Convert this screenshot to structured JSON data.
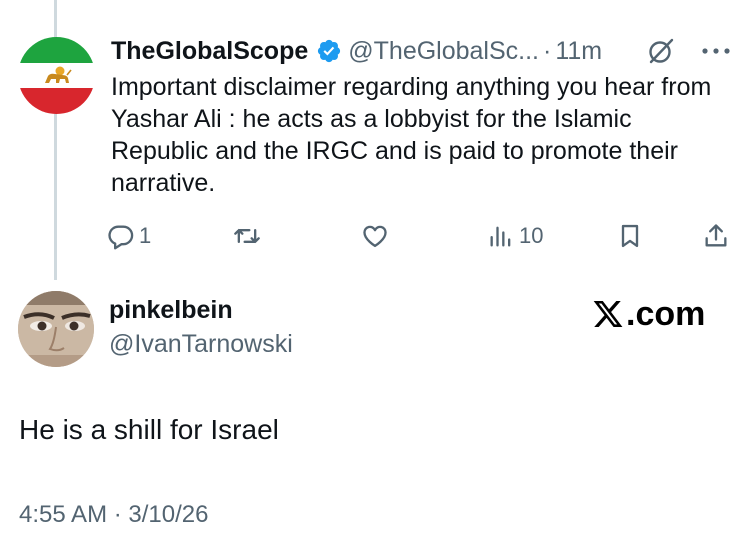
{
  "parent_tweet": {
    "author_name": "TheGlobalScope",
    "author_handle": "@TheGlobalSc...",
    "separator": "·",
    "time": "11m",
    "body": "Important disclaimer regarding anything you hear from Yashar Ali : he acts as a lobbyist for the Islamic Republic and the IRGC and is paid to promote their narrative.",
    "reply_count": "1",
    "views_count": "10",
    "icons": {
      "verified": "verified-badge-icon",
      "grok": "grok-icon",
      "more": "more-icon",
      "reply": "reply-icon",
      "retweet": "retweet-icon",
      "like": "like-icon",
      "views": "views-icon",
      "bookmark": "bookmark-icon",
      "share": "share-icon"
    }
  },
  "reply_tweet": {
    "author_name": "pinkelbein",
    "author_handle": "@IvanTarnowski",
    "text": "He is a shill for Israel",
    "timestamp": "4:55 AM · 3/10/26"
  },
  "watermark": {
    "text": ".com",
    "icon": "x-logo-icon"
  },
  "colors": {
    "primary_text": "#0f1419",
    "secondary_text": "#536471",
    "verified_blue": "#1d9bf0",
    "thread_line": "#cfd9de"
  }
}
